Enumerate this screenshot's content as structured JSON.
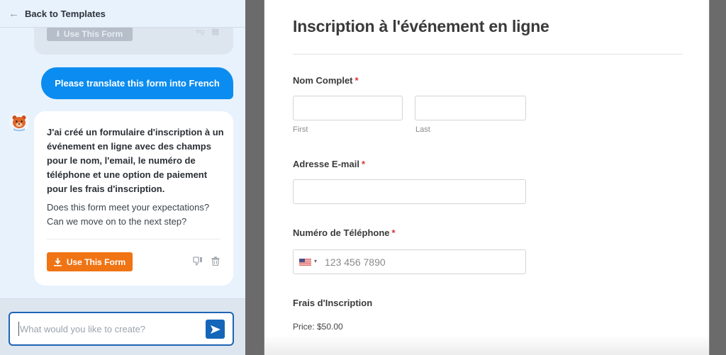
{
  "chat": {
    "header": {
      "back_label": "Back to Templates",
      "back_icon": "arrow-left-icon"
    },
    "previous_card": {
      "use_button_label": "Use This Form"
    },
    "user_message": "Please translate this form into French",
    "assistant": {
      "avatar": "bear-mascot-avatar",
      "message": "J'ai créé un formulaire d'inscription à un événement en ligne avec des champs pour le nom, l'email, le numéro de téléphone et une option de paiement pour les frais d'inscription.",
      "question": "Does this form meet your expectations? Can we move on to the next step?",
      "use_button_label": "Use This Form",
      "actions": [
        "thumbs-down-icon",
        "trash-icon"
      ]
    },
    "input": {
      "placeholder": "What would you like to create?",
      "value": "",
      "send_icon": "send-icon"
    },
    "colors": {
      "user_bubble": "#0b8cf0",
      "use_button": "#f07414",
      "send_button": "#1565b8",
      "panel_bg": "#e8f2fd"
    }
  },
  "form": {
    "title": "Inscription à l'événement en ligne",
    "fields": {
      "name": {
        "label": "Nom Complet",
        "required_mark": "*",
        "first_sublabel": "First",
        "last_sublabel": "Last",
        "first_value": "",
        "last_value": ""
      },
      "email": {
        "label": "Adresse E-mail",
        "required_mark": "*",
        "value": ""
      },
      "phone": {
        "label": "Numéro de Téléphone",
        "required_mark": "*",
        "country": "US",
        "placeholder": "123 456 7890",
        "value": ""
      },
      "fee": {
        "label": "Frais d'Inscription",
        "price_text": "Price: $50.00"
      }
    },
    "colors": {
      "required": "#d63638"
    }
  }
}
